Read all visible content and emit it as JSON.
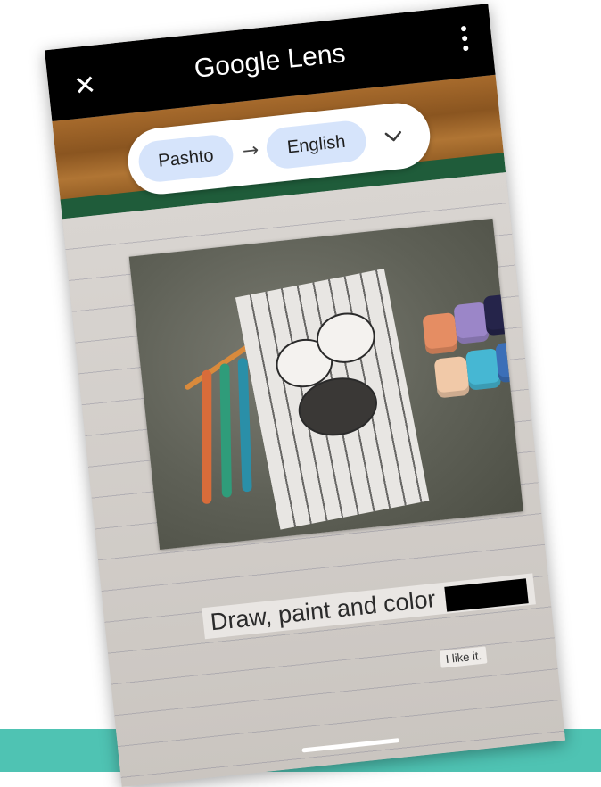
{
  "app": {
    "title": "Google Lens"
  },
  "toolbar": {
    "close_icon": "close-icon",
    "more_icon": "more-vertical-icon"
  },
  "language_bar": {
    "source_language": "Pashto",
    "arrow_icon": "arrow-right-icon",
    "target_language": "English",
    "dropdown_icon": "chevron-down-icon"
  },
  "translation": {
    "main_text": "Draw, paint and color",
    "secondary_text": "I like it."
  },
  "colors": {
    "accent_chip": "#d6e4fb",
    "top_bar": "#000000",
    "teal_band": "#4fc3b3"
  }
}
